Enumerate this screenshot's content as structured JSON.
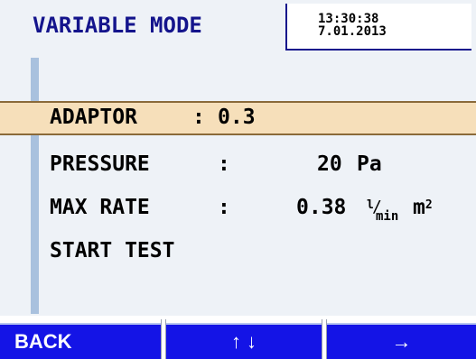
{
  "header": {
    "title": "VARIABLE MODE",
    "time": "13:30:38",
    "date": "7.01.2013"
  },
  "colors": {
    "title": "#14148c",
    "highlight": "#f6dfba",
    "softkey": "#1414e6",
    "background": "#eef2f7"
  },
  "rows": [
    {
      "label": "ADAPTOR",
      "colon": ":",
      "value": "0.3",
      "selected": true
    },
    {
      "label": "PRESSURE",
      "colon": ":",
      "value": "20",
      "unit": "Pa"
    },
    {
      "label": "MAX RATE",
      "colon": ":",
      "value": "0.38",
      "unit_numerator": "l",
      "unit_denominator": "min",
      "unit_area": "m",
      "unit_area_exp": "2"
    },
    {
      "label": "START TEST"
    }
  ],
  "softkeys": {
    "back": "BACK",
    "updown": "↑ ↓",
    "next": "→"
  }
}
